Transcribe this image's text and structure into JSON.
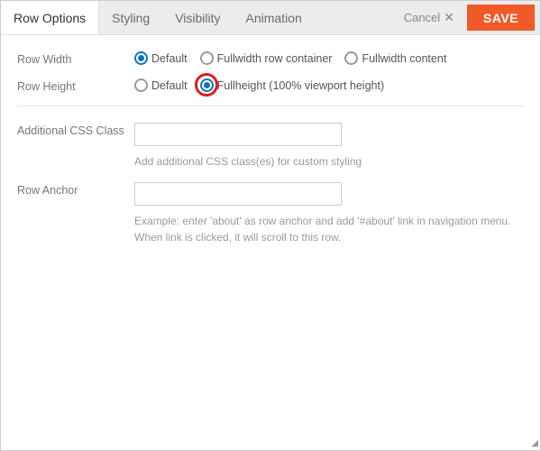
{
  "tabs": {
    "row_options": "Row Options",
    "styling": "Styling",
    "visibility": "Visibility",
    "animation": "Animation"
  },
  "actions": {
    "cancel": "Cancel",
    "save": "SAVE"
  },
  "fields": {
    "row_width": {
      "label": "Row Width",
      "options": {
        "default": "Default",
        "fullwidth_container": "Fullwidth row container",
        "fullwidth_content": "Fullwidth content"
      }
    },
    "row_height": {
      "label": "Row Height",
      "options": {
        "default": "Default",
        "fullheight": "Fullheight (100% viewport height)"
      }
    },
    "css_class": {
      "label": "Additional CSS Class",
      "value": "",
      "help": "Add additional CSS class(es) for custom styling"
    },
    "row_anchor": {
      "label": "Row Anchor",
      "value": "",
      "help": "Example: enter 'about' as row anchor and add '#about' link in navigation menu. When link is clicked, it will scroll to this row."
    }
  }
}
